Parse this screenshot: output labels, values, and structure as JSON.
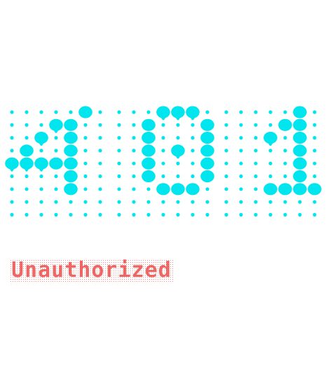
{
  "error": {
    "code_digits": [
      "4",
      "0",
      "1"
    ],
    "message": "Unauthorized"
  },
  "footer": {
    "line1": "",
    "line2": ""
  },
  "colors": {
    "dot": "#00e5ee",
    "message": "#e53935",
    "background": "#ffffff"
  }
}
